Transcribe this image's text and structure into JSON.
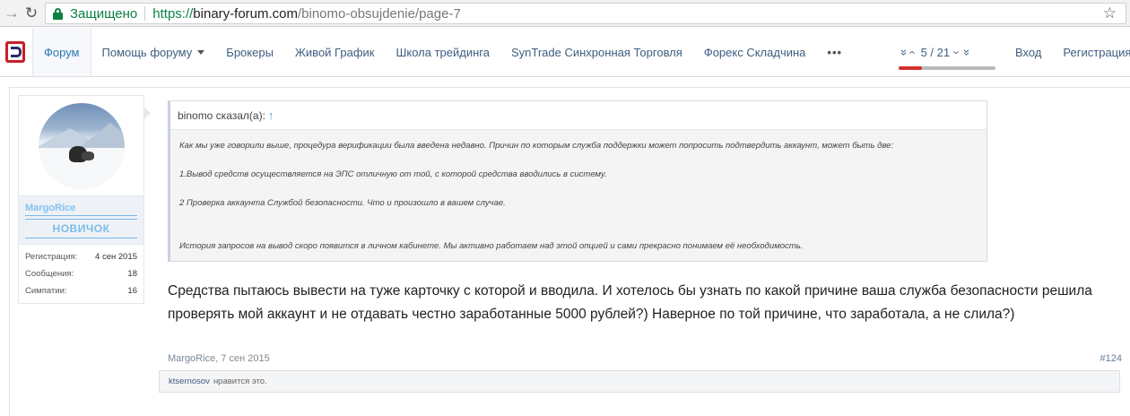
{
  "browser": {
    "secure_label": "Защищено",
    "url_scheme": "https://",
    "url_host": "binary-forum.com",
    "url_path": "/binomo-obsujdenie/page-7"
  },
  "nav": {
    "items": [
      {
        "label": "Форум",
        "active": true
      },
      {
        "label": "Помощь форуму",
        "dropdown": true
      },
      {
        "label": "Брокеры"
      },
      {
        "label": "Живой График"
      },
      {
        "label": "Школа трейдинга"
      },
      {
        "label": "SynTrade Синхронная Торговля"
      },
      {
        "label": "Форекс Складчина"
      },
      {
        "label": "•••"
      }
    ],
    "pager": {
      "first": "«",
      "prev": "‹",
      "text": "5 / 21",
      "next": "›",
      "last": "»",
      "progress": 0.2381
    },
    "login": "Вход",
    "register": "Регистрация"
  },
  "colors": {
    "brand_red": "#c81e2a",
    "link": "#3d5d80",
    "rank_blue": "#7bbbe8"
  },
  "user": {
    "name": "MargoRice",
    "rank": "НОВИЧОК",
    "stats": [
      {
        "label": "Регистрация:",
        "value": "4 сен 2015"
      },
      {
        "label": "Сообщения:",
        "value": "18"
      },
      {
        "label": "Симпатии:",
        "value": "16"
      }
    ]
  },
  "post": {
    "quote_author": "binomo сказал(а):",
    "quote_arrow": "↑",
    "quote_lines": [
      "Как мы уже говорили выше, процедура верификации была введена недавно. Причин по которым служба поддержки может попросить подтвердить аккаунт, может быть две:",
      "",
      "1.Вывод средств осуществляется на ЭПС отличную от той, с которой средства вводились в систему.",
      "",
      "2 Проверка аккаунта Службой безопасности. Что и произошло в вашем случае.",
      "",
      "",
      "История запросов на вывод скоро появится в личном кабинете. Мы активно работаем над этой опцией и сами прекрасно понимаем её необходимость."
    ],
    "text": "Средства пытаюсь вывести на туже карточку с которой и вводила. И хотелось бы узнать по какой причине ваша служба безопасности решила проверять мой аккаунт и не отдавать честно заработанные 5000 рублей?) Наверное по той причине, что заработала, а не слила?)",
    "author": "MargoRice",
    "date": "7 сен 2015",
    "number": "#124",
    "liker": "ktsernosov",
    "likes_suffix": "нравится это."
  }
}
